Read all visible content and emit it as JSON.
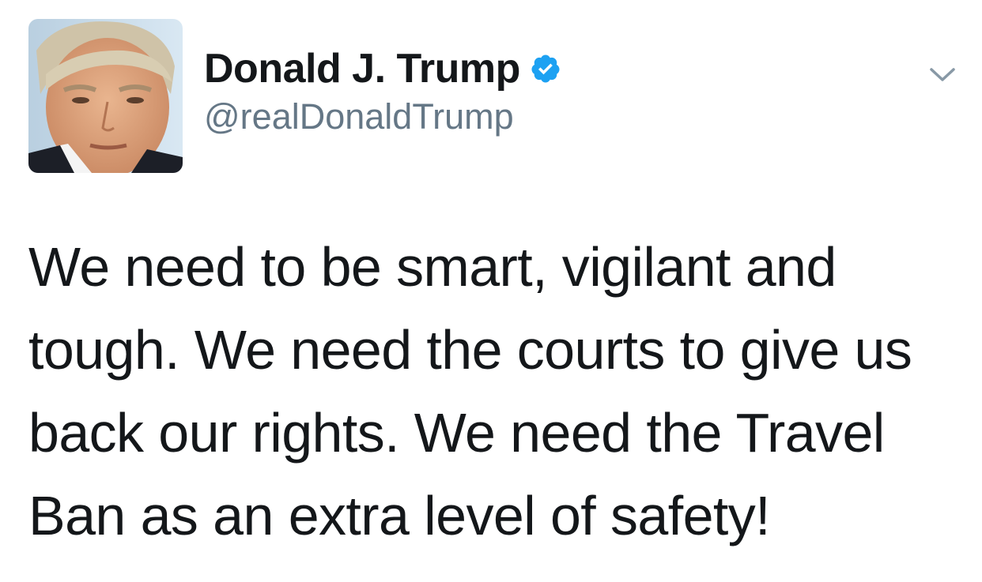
{
  "author": {
    "display_name": "Donald J. Trump",
    "handle": "@realDonaldTrump",
    "verified": true
  },
  "icons": {
    "verified": "verified-badge-icon",
    "menu": "chevron-down-icon"
  },
  "tweet": {
    "lines": [
      "We need to be smart, vigilant and",
      "tough. We need the courts to give us",
      "back our rights. We need the Travel",
      "Ban as an extra level of safety!"
    ]
  },
  "colors": {
    "verified_blue": "#1da1f2",
    "handle_gray": "#657786",
    "text": "#14171a"
  }
}
